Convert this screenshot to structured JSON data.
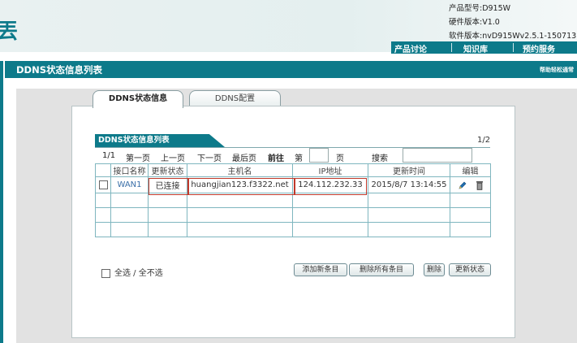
{
  "header": {
    "brand_fragment": "丟",
    "product_model": "产品型号:D915W",
    "hardware_version": "硬件版本:V1.0",
    "software_version": "软件版本:nvD915Wv2.5.1-150713",
    "nav": [
      "产品讨论",
      "知识库",
      "预约服务"
    ]
  },
  "page": {
    "title": "DDNS状态信息列表",
    "help_link": "帮助轻松通常"
  },
  "tabs": [
    {
      "label": "DDNS状态信息",
      "active": true
    },
    {
      "label": "DDNS配置",
      "active": false
    }
  ],
  "list": {
    "title": "DDNS状态信息列表",
    "page_count": "1/2",
    "pager": {
      "current": "1/1",
      "first": "第一页",
      "prev": "上一页",
      "next": "下一页",
      "last": "最后页",
      "goto": "前往",
      "page_prefix": "第",
      "page_suffix": "页",
      "search": "搜索",
      "page_value": "",
      "search_value": ""
    },
    "columns": [
      "接口名称",
      "更新状态",
      "主机名",
      "IP地址",
      "更新时间",
      "编辑"
    ],
    "rows": [
      {
        "interface": "WAN1",
        "status": "已连接",
        "hostname": "huangjian123.f3322.net",
        "ip": "124.112.232.33",
        "time": "2015/8/7 13:14:55"
      }
    ]
  },
  "footer": {
    "select_all": "全选 / 全不选",
    "buttons": {
      "add": "添加新条目",
      "delete_all": "删除所有条目",
      "delete": "删除",
      "update": "更新状态"
    }
  },
  "colors": {
    "accent": "#0d7a8a",
    "grid_border": "#7fb6bf",
    "highlight": "#c0392b"
  },
  "icons": [
    "edit-icon",
    "trash-icon"
  ]
}
